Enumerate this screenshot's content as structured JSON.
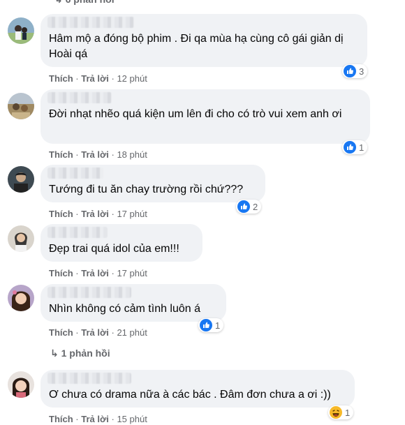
{
  "top_reply_label": "↳ 6 phản hồi",
  "action_like": "Thích",
  "action_reply": "Trả lời",
  "separator": "·",
  "colors": {
    "bubble": "#f0f2f5",
    "meta": "#65676b",
    "like_blue": "#1877f2"
  },
  "comments": [
    {
      "text": "Hâm mộ a đóng bộ phim . Đi qa mùa hạ cùng cô gái giản dị Hoài qá",
      "time": "12 phút",
      "reaction_icon": "like-icon",
      "reaction_count": "3"
    },
    {
      "text": "Đời nhạt nhẽo quá kiện um lên đi cho có trò vui xem anh ơi",
      "time": "18 phút",
      "reaction_icon": "like-icon",
      "reaction_count": "1"
    },
    {
      "text": "Tướng đi tu ăn chay trường rồi chứ???",
      "time": "17 phút",
      "reaction_icon": "like-icon",
      "reaction_count": "2"
    },
    {
      "text": "Đẹp trai quá idol của em!!!",
      "time": "17 phút"
    },
    {
      "text": "Nhìn không có cảm tình luôn á",
      "time": "21 phút",
      "reaction_icon": "like-icon",
      "reaction_count": "1"
    },
    {
      "text": "Ơ chưa có drama nữa à các bác . Đâm đơn chưa a ơi :))",
      "time": "15 phút",
      "reaction_icon": "haha-icon",
      "reaction_count": "1"
    }
  ],
  "replies_label": "1 phản hồi",
  "replies_icon": "reply-arrow-icon"
}
